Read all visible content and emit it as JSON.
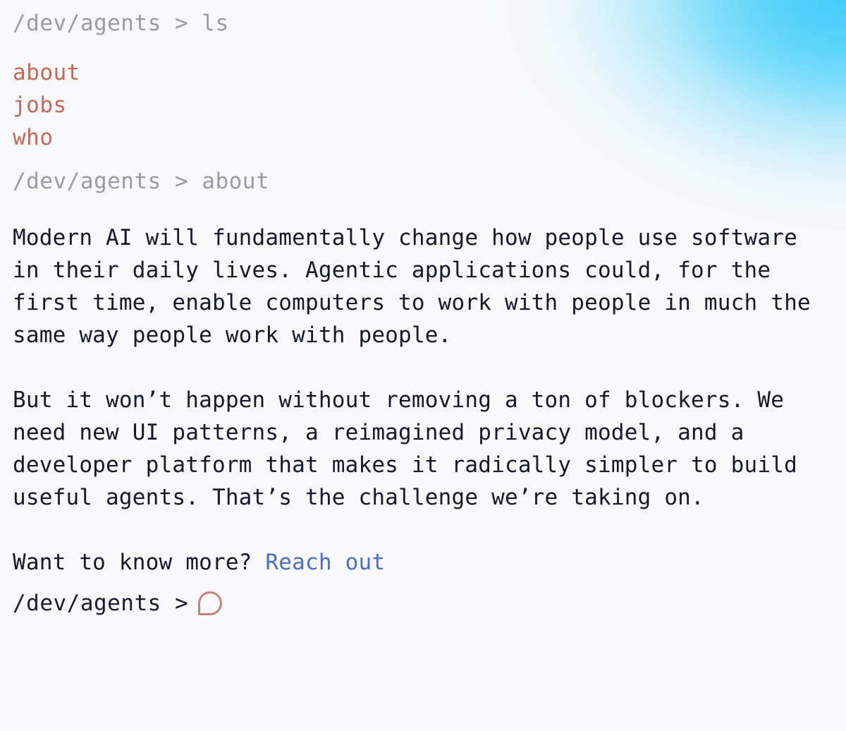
{
  "terminal": {
    "prompt_path": "/dev/agents",
    "prompt_symbol": ">",
    "background_color": "#f8f8fa",
    "accent_color": "#c4685a",
    "link_color": "#4a6fc4",
    "text_color": "#17172e",
    "dim_color": "#9a9aa8",
    "glow_color": "#53d1fa"
  },
  "command_ls": {
    "path": "/dev/agents",
    "symbol": ">",
    "command": "ls",
    "full_line": "/dev/agents > ls"
  },
  "ls_output": {
    "entries": [
      {
        "name": "about"
      },
      {
        "name": "jobs"
      },
      {
        "name": "who"
      }
    ]
  },
  "command_about": {
    "path": "/dev/agents",
    "symbol": ">",
    "command": "about",
    "full_line": "/dev/agents > about"
  },
  "about_output": {
    "paragraph_1": "Modern AI will fundamentally change how people use software in their daily lives. Agentic applications could, for the first time, enable computers to work with people in much the same way people work with people.",
    "paragraph_2": "But it won’t happen without removing a ton of blockers. We need new UI patterns, a reimagined privacy model, and a developer platform that makes it radically simpler to build useful agents. That’s the challenge we’re taking on.",
    "paragraph_3_prefix": "Want to know more? ",
    "paragraph_3_link": "Reach out"
  },
  "active_prompt": {
    "path": "/dev/agents",
    "symbol": ">",
    "full_line": "/dev/agents >",
    "cursor_icon": "speech-bubble-icon"
  }
}
